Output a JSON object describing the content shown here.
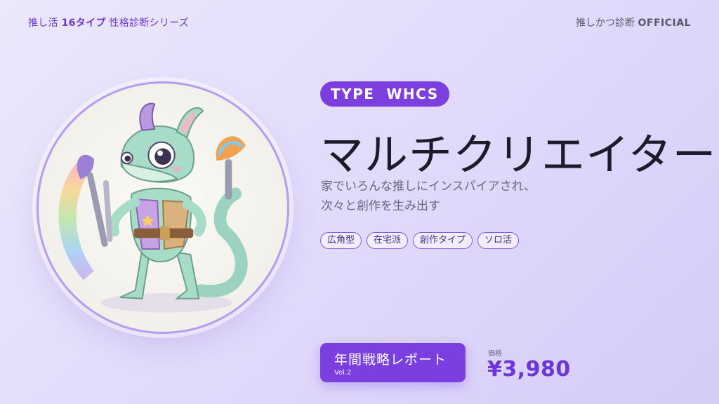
{
  "header": {
    "series_prefix": "推し活 ",
    "series_strong": "16タイプ",
    "series_suffix": " 性格診断シリーズ",
    "brand_prefix": "推しかつ診断 ",
    "brand_strong": "OFFICIAL"
  },
  "portrait": {
    "icon": "chameleon-painter-illustration"
  },
  "type": {
    "badge": "TYPE  WHCS",
    "name": "マルチクリエイター",
    "description": [
      "家でいろんな推しにインスパイアされ、",
      "次々と創作を生み出す"
    ],
    "tags": [
      "広角型",
      "在宅派",
      "創作タイプ",
      "ソロ活"
    ]
  },
  "cta": {
    "label": "年間戦略レポート",
    "sub": "Vol.2"
  },
  "price": {
    "label": "価格",
    "value": "¥3,980"
  },
  "colors": {
    "accent": "#7b3fe0",
    "accent_text": "#6d35d6",
    "background": "#e4defa"
  }
}
